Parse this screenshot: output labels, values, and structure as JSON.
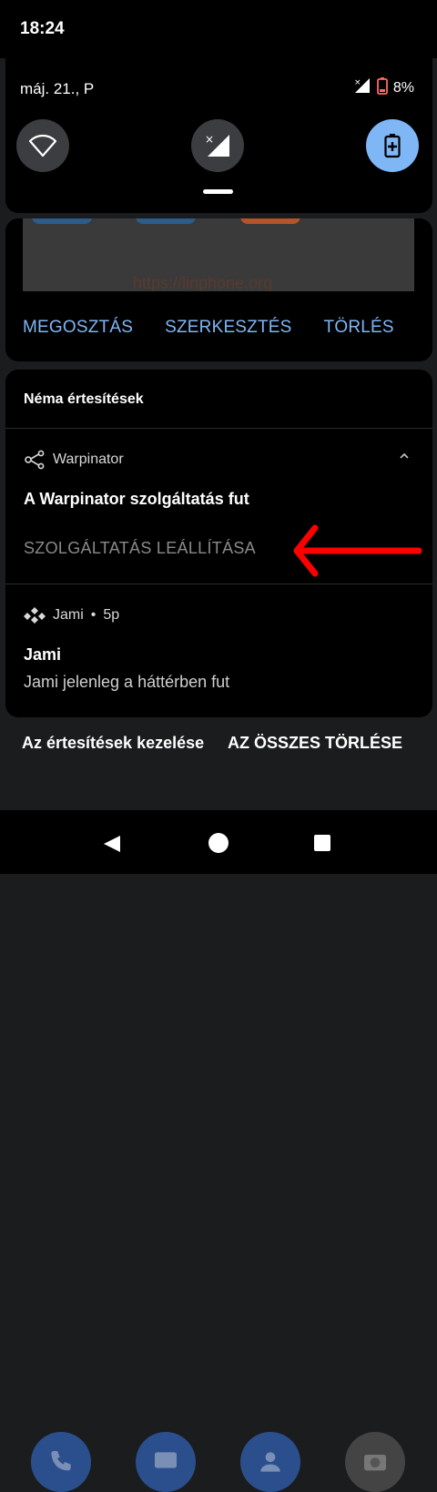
{
  "status": {
    "time": "18:24"
  },
  "quick_settings": {
    "date": "máj. 21., P",
    "battery": "8%",
    "tiles": [
      {
        "name": "wifi",
        "active": false
      },
      {
        "name": "mobile-data",
        "active": false
      },
      {
        "name": "battery-saver",
        "active": true
      }
    ]
  },
  "share": {
    "url": "https://linphone.org",
    "actions": [
      "MEGOSZTÁS",
      "SZERKESZTÉS",
      "TÖRLÉS"
    ]
  },
  "silent": {
    "title": "Néma értesítések",
    "warpinator": {
      "app": "Warpinator",
      "title": "A Warpinator szolgáltatás fut",
      "action": "SZOLGÁLTATÁS LEÁLLÍTÁSA"
    },
    "jami": {
      "app": "Jami",
      "time": "5p",
      "title": "Jami",
      "text": "Jami jelenleg a háttérben fut"
    }
  },
  "footer": {
    "manage": "Az értesítések kezelése",
    "clear_all": "AZ ÖSSZES TÖRLÉSE"
  },
  "colors": {
    "accent": "#7fb6f5",
    "arrow": "#ff0000",
    "card": "#000000",
    "bg": "#1b1c1e"
  }
}
